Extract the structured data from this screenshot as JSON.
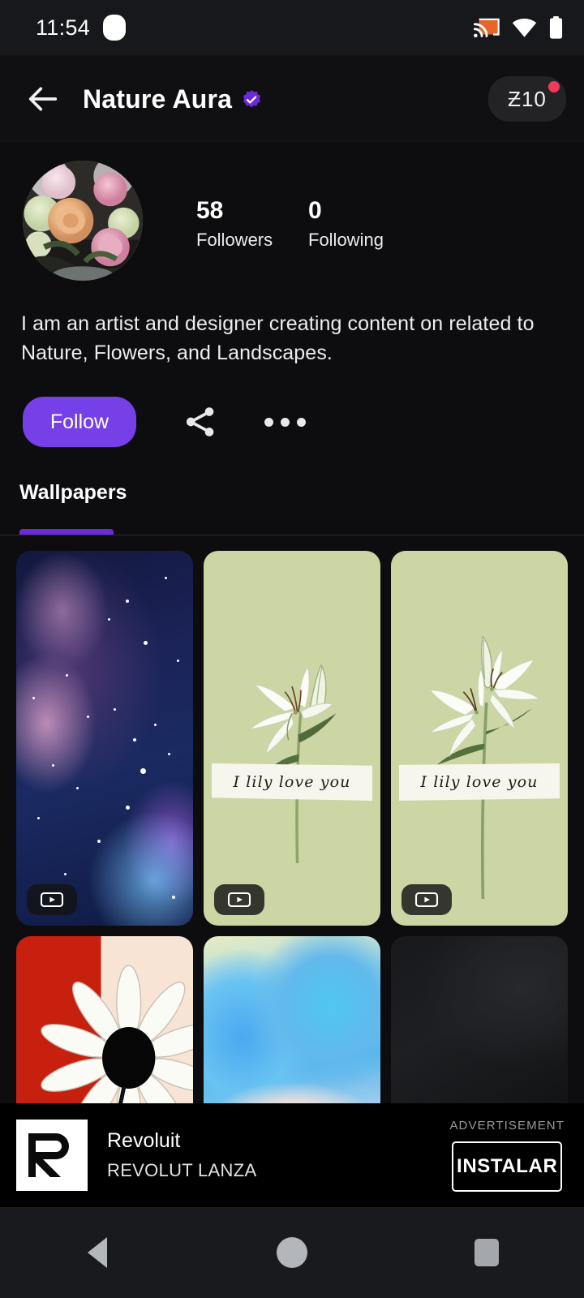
{
  "status_bar": {
    "clock": "11:54",
    "icons": [
      "cast-icon",
      "wifi-icon",
      "battery-icon"
    ],
    "cast_color": "#e8652a"
  },
  "app_bar": {
    "back_label": "back-arrow",
    "title": "Nature Aura",
    "verified": true,
    "verified_color": "#6c2bd9",
    "token_label": "Ƶ10",
    "token_dot_color": "#ef3b57"
  },
  "profile": {
    "avatar_alt": "floral bouquet avatar",
    "stats": [
      {
        "value": "58",
        "label": "Followers"
      },
      {
        "value": "0",
        "label": "Following"
      }
    ],
    "bio": "I am an artist and designer creating content on related to Nature, Flowers, and Landscapes."
  },
  "actions": {
    "follow_label": "Follow",
    "follow_color": "#7540e8",
    "share_label": "share-icon",
    "more_label": "more-options-icon"
  },
  "tabs": {
    "items": [
      {
        "label": "Wallpapers",
        "active": true
      }
    ],
    "indicator_color": "#6c2bd9"
  },
  "grid": {
    "items": [
      {
        "name": "wallpaper-galaxy",
        "style": "galaxy",
        "video": true,
        "caption": ""
      },
      {
        "name": "wallpaper-lily-single",
        "style": "lily1",
        "video": true,
        "caption": "I lily love you"
      },
      {
        "name": "wallpaper-lily-double",
        "style": "lily2",
        "video": true,
        "caption": "I lily love you"
      },
      {
        "name": "wallpaper-daisy",
        "style": "daisy",
        "video": false,
        "caption": ""
      },
      {
        "name": "wallpaper-abstract-blue",
        "style": "abstract",
        "video": false,
        "caption": ""
      },
      {
        "name": "wallpaper-dark",
        "style": "dark",
        "video": false,
        "caption": ""
      }
    ]
  },
  "ad": {
    "logo_letter": "R",
    "title": "Revoluit",
    "subtitle": "REVOLUT LANZA",
    "flag": "ADVERTISEMENT",
    "install_label": "INSTALAR"
  },
  "nav_bar": {
    "back": "nav-back-button",
    "home": "nav-home-button",
    "recents": "nav-recents-button"
  }
}
